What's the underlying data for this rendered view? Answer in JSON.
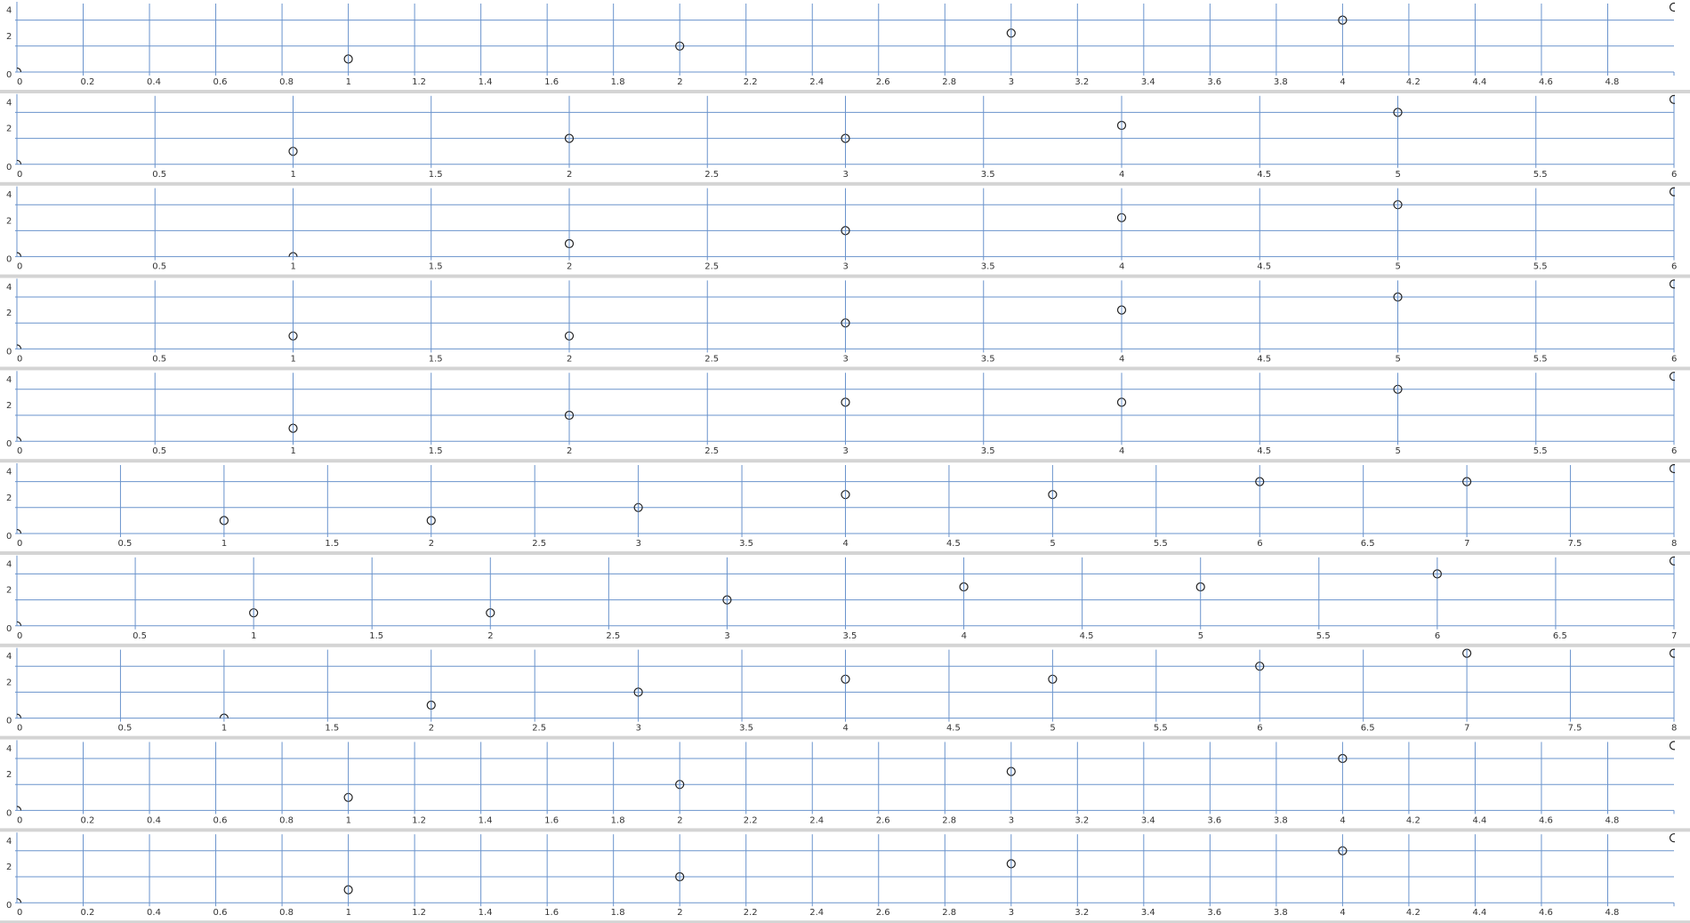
{
  "colors": {
    "grid": "#6a93cc",
    "marker": "#222222",
    "separator": "#d4d4d4",
    "text": "#333333"
  },
  "chart_data": [
    {
      "type": "scatter",
      "xlim": [
        0,
        5
      ],
      "ylim": [
        0,
        5
      ],
      "xticks": [
        "0",
        "0.2",
        "0.4",
        "0.6",
        "0.8",
        "1",
        "1.2",
        "1.4",
        "1.6",
        "1.8",
        "2",
        "2.2",
        "2.4",
        "2.6",
        "2.8",
        "3",
        "3.2",
        "3.4",
        "3.6",
        "3.8",
        "4",
        "4.2",
        "4.4",
        "4.6",
        "4.8"
      ],
      "yticks": [
        "0",
        "2",
        "4"
      ],
      "grid": true,
      "points": [
        {
          "x": 0,
          "y": 0
        },
        {
          "x": 1,
          "y": 1
        },
        {
          "x": 2,
          "y": 2
        },
        {
          "x": 3,
          "y": 3
        },
        {
          "x": 4,
          "y": 4
        },
        {
          "x": 5,
          "y": 5
        }
      ]
    },
    {
      "type": "scatter",
      "xlim": [
        0,
        6
      ],
      "ylim": [
        0,
        5
      ],
      "xticks": [
        "0",
        "0.5",
        "1",
        "1.5",
        "2",
        "2.5",
        "3",
        "3.5",
        "4",
        "4.5",
        "5",
        "5.5",
        "6"
      ],
      "yticks": [
        "0",
        "2",
        "4"
      ],
      "grid": true,
      "points": [
        {
          "x": 0,
          "y": 0
        },
        {
          "x": 1,
          "y": 1
        },
        {
          "x": 2,
          "y": 2
        },
        {
          "x": 3,
          "y": 2
        },
        {
          "x": 4,
          "y": 3
        },
        {
          "x": 5,
          "y": 4
        },
        {
          "x": 6,
          "y": 5
        }
      ]
    },
    {
      "type": "scatter",
      "xlim": [
        0,
        6
      ],
      "ylim": [
        0,
        5
      ],
      "xticks": [
        "0",
        "0.5",
        "1",
        "1.5",
        "2",
        "2.5",
        "3",
        "3.5",
        "4",
        "4.5",
        "5",
        "5.5",
        "6"
      ],
      "yticks": [
        "0",
        "2",
        "4"
      ],
      "grid": true,
      "points": [
        {
          "x": 0,
          "y": 0
        },
        {
          "x": 1,
          "y": 0
        },
        {
          "x": 2,
          "y": 1
        },
        {
          "x": 3,
          "y": 2
        },
        {
          "x": 4,
          "y": 3
        },
        {
          "x": 5,
          "y": 4
        },
        {
          "x": 6,
          "y": 5
        }
      ]
    },
    {
      "type": "scatter",
      "xlim": [
        0,
        6
      ],
      "ylim": [
        0,
        5
      ],
      "xticks": [
        "0",
        "0.5",
        "1",
        "1.5",
        "2",
        "2.5",
        "3",
        "3.5",
        "4",
        "4.5",
        "5",
        "5.5",
        "6"
      ],
      "yticks": [
        "0",
        "2",
        "4"
      ],
      "grid": true,
      "points": [
        {
          "x": 0,
          "y": 0
        },
        {
          "x": 1,
          "y": 1
        },
        {
          "x": 2,
          "y": 1
        },
        {
          "x": 3,
          "y": 2
        },
        {
          "x": 4,
          "y": 3
        },
        {
          "x": 5,
          "y": 4
        },
        {
          "x": 6,
          "y": 5
        }
      ]
    },
    {
      "type": "scatter",
      "xlim": [
        0,
        6
      ],
      "ylim": [
        0,
        5
      ],
      "xticks": [
        "0",
        "0.5",
        "1",
        "1.5",
        "2",
        "2.5",
        "3",
        "3.5",
        "4",
        "4.5",
        "5",
        "5.5",
        "6"
      ],
      "yticks": [
        "0",
        "2",
        "4"
      ],
      "grid": true,
      "points": [
        {
          "x": 0,
          "y": 0
        },
        {
          "x": 1,
          "y": 1
        },
        {
          "x": 2,
          "y": 2
        },
        {
          "x": 3,
          "y": 3
        },
        {
          "x": 4,
          "y": 3
        },
        {
          "x": 5,
          "y": 4
        },
        {
          "x": 6,
          "y": 5
        }
      ]
    },
    {
      "type": "scatter",
      "xlim": [
        0,
        8
      ],
      "ylim": [
        0,
        5
      ],
      "xticks": [
        "0",
        "0.5",
        "1",
        "1.5",
        "2",
        "2.5",
        "3",
        "3.5",
        "4",
        "4.5",
        "5",
        "5.5",
        "6",
        "6.5",
        "7",
        "7.5",
        "8"
      ],
      "yticks": [
        "0",
        "2",
        "4"
      ],
      "grid": true,
      "points": [
        {
          "x": 0,
          "y": 0
        },
        {
          "x": 1,
          "y": 1
        },
        {
          "x": 2,
          "y": 1
        },
        {
          "x": 3,
          "y": 2
        },
        {
          "x": 4,
          "y": 3
        },
        {
          "x": 5,
          "y": 3
        },
        {
          "x": 6,
          "y": 4
        },
        {
          "x": 7,
          "y": 4
        },
        {
          "x": 8,
          "y": 5
        }
      ]
    },
    {
      "type": "scatter",
      "xlim": [
        0,
        7
      ],
      "ylim": [
        0,
        5
      ],
      "xticks": [
        "0",
        "0.5",
        "1",
        "1.5",
        "2",
        "2.5",
        "3",
        "3.5",
        "4",
        "4.5",
        "5",
        "5.5",
        "6",
        "6.5",
        "7"
      ],
      "yticks": [
        "0",
        "2",
        "4"
      ],
      "grid": true,
      "points": [
        {
          "x": 0,
          "y": 0
        },
        {
          "x": 1,
          "y": 1
        },
        {
          "x": 2,
          "y": 1
        },
        {
          "x": 3,
          "y": 2
        },
        {
          "x": 4,
          "y": 3
        },
        {
          "x": 5,
          "y": 3
        },
        {
          "x": 6,
          "y": 4
        },
        {
          "x": 7,
          "y": 5
        }
      ]
    },
    {
      "type": "scatter",
      "xlim": [
        0,
        8
      ],
      "ylim": [
        0,
        5
      ],
      "xticks": [
        "0",
        "0.5",
        "1",
        "1.5",
        "2",
        "2.5",
        "3",
        "3.5",
        "4",
        "4.5",
        "5",
        "5.5",
        "6",
        "6.5",
        "7",
        "7.5",
        "8"
      ],
      "yticks": [
        "0",
        "2",
        "4"
      ],
      "grid": true,
      "points": [
        {
          "x": 0,
          "y": 0
        },
        {
          "x": 1,
          "y": 0
        },
        {
          "x": 2,
          "y": 1
        },
        {
          "x": 3,
          "y": 2
        },
        {
          "x": 4,
          "y": 3
        },
        {
          "x": 5,
          "y": 3
        },
        {
          "x": 6,
          "y": 4
        },
        {
          "x": 7,
          "y": 5
        },
        {
          "x": 8,
          "y": 5
        }
      ]
    },
    {
      "type": "scatter",
      "xlim": [
        0,
        5
      ],
      "ylim": [
        0,
        5
      ],
      "xticks": [
        "0",
        "0.2",
        "0.4",
        "0.6",
        "0.8",
        "1",
        "1.2",
        "1.4",
        "1.6",
        "1.8",
        "2",
        "2.2",
        "2.4",
        "2.6",
        "2.8",
        "3",
        "3.2",
        "3.4",
        "3.6",
        "3.8",
        "4",
        "4.2",
        "4.4",
        "4.6",
        "4.8"
      ],
      "yticks": [
        "0",
        "2",
        "4"
      ],
      "grid": true,
      "points": [
        {
          "x": 0,
          "y": 0
        },
        {
          "x": 1,
          "y": 1
        },
        {
          "x": 2,
          "y": 2
        },
        {
          "x": 3,
          "y": 3
        },
        {
          "x": 4,
          "y": 4
        },
        {
          "x": 5,
          "y": 5
        }
      ]
    },
    {
      "type": "scatter",
      "xlim": [
        0,
        5
      ],
      "ylim": [
        0,
        5
      ],
      "xticks": [
        "0",
        "0.2",
        "0.4",
        "0.6",
        "0.8",
        "1",
        "1.2",
        "1.4",
        "1.6",
        "1.8",
        "2",
        "2.2",
        "2.4",
        "2.6",
        "2.8",
        "3",
        "3.2",
        "3.4",
        "3.6",
        "3.8",
        "4",
        "4.2",
        "4.4",
        "4.6",
        "4.8"
      ],
      "yticks": [
        "0",
        "2",
        "4"
      ],
      "grid": true,
      "points": [
        {
          "x": 0,
          "y": 0
        },
        {
          "x": 1,
          "y": 1
        },
        {
          "x": 2,
          "y": 2
        },
        {
          "x": 3,
          "y": 3
        },
        {
          "x": 4,
          "y": 4
        },
        {
          "x": 5,
          "y": 5
        }
      ]
    }
  ]
}
